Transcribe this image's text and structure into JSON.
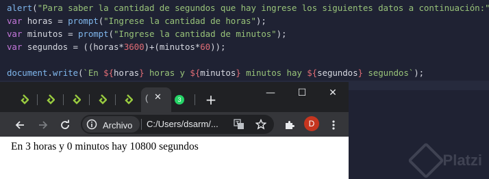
{
  "editor": {
    "lines": [
      {
        "parts": [
          [
            "fn",
            "alert"
          ],
          [
            "op",
            "("
          ],
          [
            "str",
            "\"Para saber la cantidad de segundos que hay ingrese los siguientes datos a continuación:\""
          ],
          [
            "op",
            ");"
          ]
        ]
      },
      {
        "parts": [
          [
            "kw",
            "var"
          ],
          [
            "var",
            " horas "
          ],
          [
            "op",
            "= "
          ],
          [
            "fn",
            "prompt"
          ],
          [
            "op",
            "("
          ],
          [
            "str",
            "\"Ingrese la cantidad de horas\""
          ],
          [
            "op",
            ");"
          ]
        ]
      },
      {
        "parts": [
          [
            "kw",
            "var"
          ],
          [
            "var",
            " minutos "
          ],
          [
            "op",
            "= "
          ],
          [
            "fn",
            "prompt"
          ],
          [
            "op",
            "("
          ],
          [
            "str",
            "\"Ingrese la cantidad de minutos\""
          ],
          [
            "op",
            ");"
          ]
        ]
      },
      {
        "parts": [
          [
            "kw",
            "var"
          ],
          [
            "var",
            " segundos "
          ],
          [
            "op",
            "= (("
          ],
          [
            "var",
            "horas"
          ],
          [
            "op",
            "*"
          ],
          [
            "num",
            "3600"
          ],
          [
            "op",
            ")+("
          ],
          [
            "var",
            "minutos"
          ],
          [
            "op",
            "*"
          ],
          [
            "num",
            "60"
          ],
          [
            "op",
            "));"
          ]
        ]
      },
      {
        "parts": []
      },
      {
        "parts": [
          [
            "fn",
            "document"
          ],
          [
            "op",
            "."
          ],
          [
            "prop",
            "write"
          ],
          [
            "op",
            "("
          ],
          [
            "str",
            "`En "
          ],
          [
            "tmpl",
            "${"
          ],
          [
            "var",
            "horas"
          ],
          [
            "tmpl",
            "}"
          ],
          [
            "str",
            " horas y "
          ],
          [
            "tmpl",
            "${"
          ],
          [
            "var",
            "minutos"
          ],
          [
            "tmpl",
            "}"
          ],
          [
            "str",
            " minutos hay "
          ],
          [
            "tmpl",
            "${"
          ],
          [
            "var",
            "segundos"
          ],
          [
            "tmpl",
            "}"
          ],
          [
            "str",
            " segundos`"
          ],
          [
            "op",
            ");"
          ]
        ]
      }
    ]
  },
  "watermark": {
    "text": "Platzi"
  },
  "browser": {
    "tabs": [
      {
        "icon": "platzi-icon"
      },
      {
        "icon": "platzi-icon"
      },
      {
        "icon": "platzi-icon"
      },
      {
        "icon": "platzi-icon"
      },
      {
        "icon": "platzi-icon"
      }
    ],
    "active_tab": {
      "title": "(",
      "close": "✕"
    },
    "whatsapp_badge": "3",
    "new_tab": "+",
    "window_controls": {
      "minimize": "—",
      "maximize": "☐",
      "close": "✕"
    },
    "omnibox": {
      "chip": "Archivo",
      "url": "C:/Users/dsarm/..."
    },
    "avatar": "D",
    "page_text": "En 3 horas y 0 minutos hay 10800 segundos"
  },
  "colors": {
    "editor_bg": "#1f2233",
    "keyword": "#c678dd",
    "string": "#98c379",
    "function": "#7fb6ec",
    "number": "#e06c75",
    "platzi_green": "#98ca3f"
  }
}
